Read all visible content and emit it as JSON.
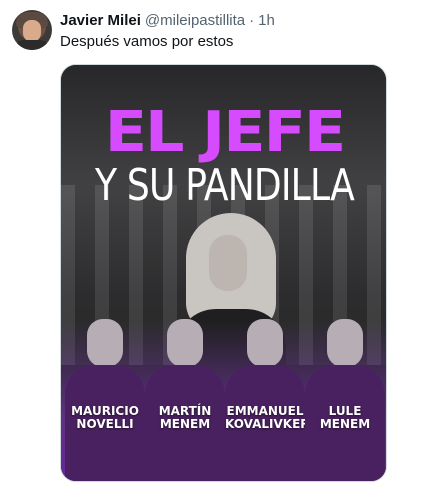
{
  "tweet": {
    "author_name": "Javier Milei",
    "author_handle": "@mileipastillita",
    "separator": "·",
    "time": "1h",
    "text": "Después vamos por estos"
  },
  "image": {
    "title_line1": "EL JEFE",
    "title_line2": "Y SU PANDILLA",
    "people": [
      {
        "first": "MAURICIO",
        "last": "NOVELLI"
      },
      {
        "first": "MARTÍN",
        "last": "MENEM"
      },
      {
        "first": "EMMANUEL",
        "last": "KOVALIVKER"
      },
      {
        "first": "LULE",
        "last": "MENEM"
      }
    ]
  },
  "colors": {
    "title_accent": "#d74bff",
    "purple_overlay": "#8c3cc8",
    "handle_gray": "#536471"
  }
}
